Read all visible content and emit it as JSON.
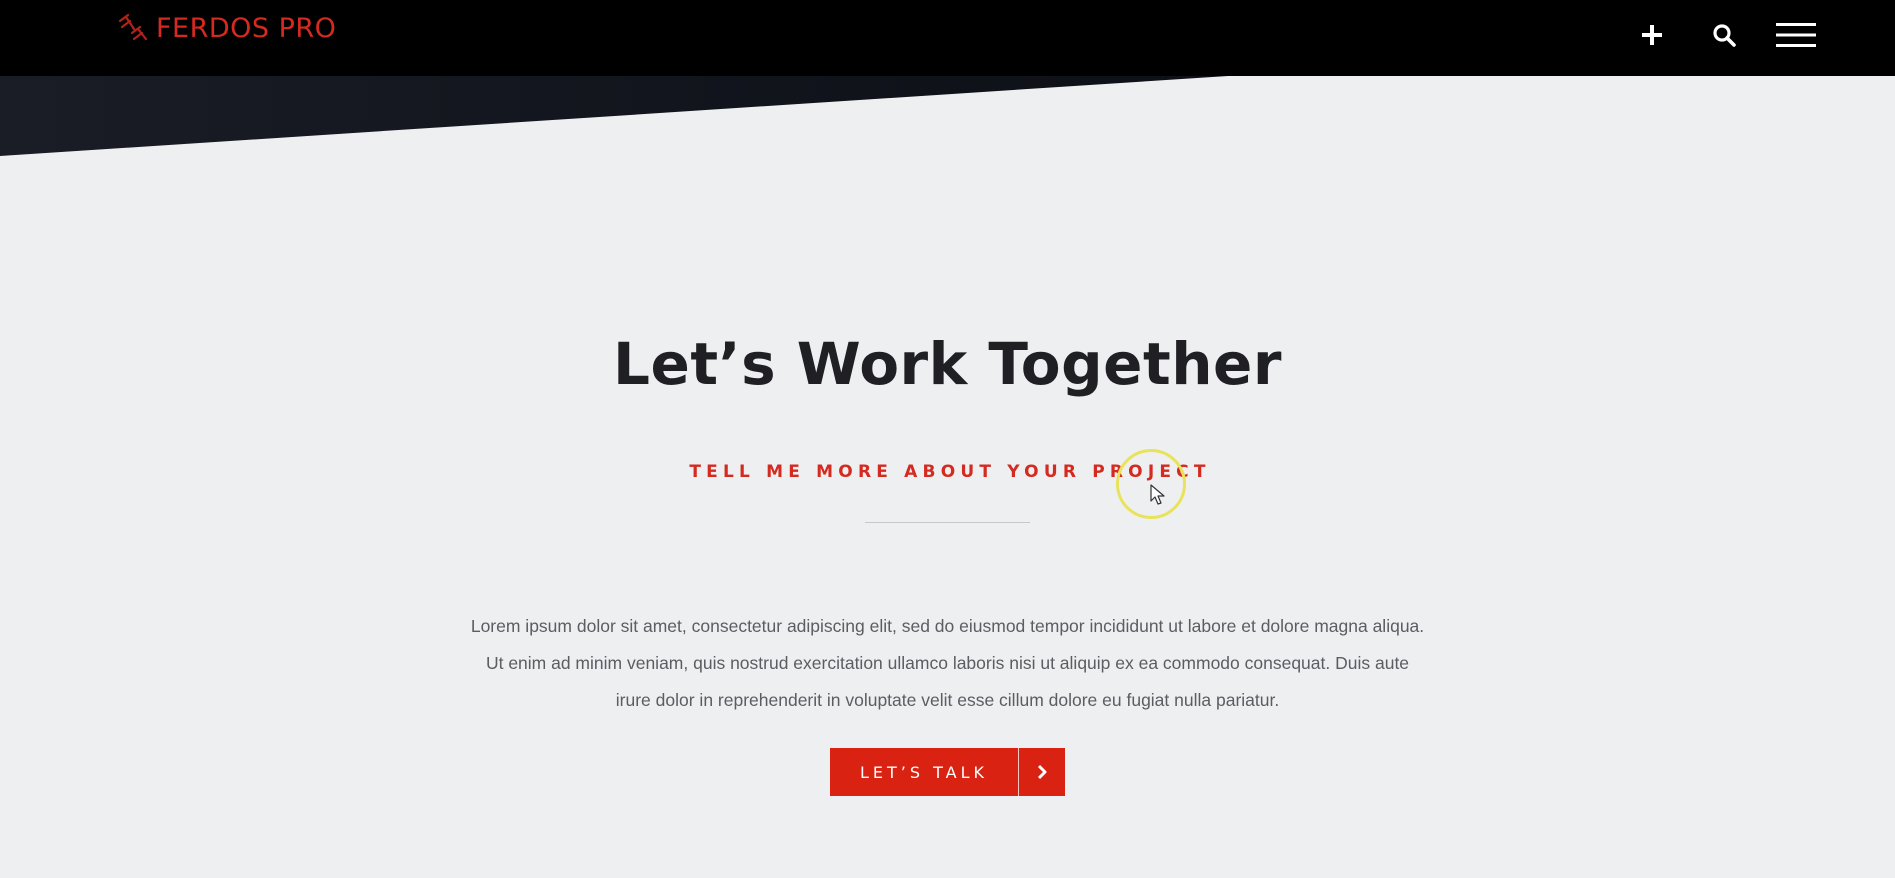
{
  "header": {
    "logo_text": "FERDOS PRO",
    "icons": [
      "plus-icon",
      "search-icon",
      "menu-icon"
    ]
  },
  "hero": {
    "heading": "Let’s Work Together",
    "subheading": "TELL ME MORE ABOUT YOUR PROJECT",
    "body": "Lorem ipsum dolor sit amet, consectetur adipiscing elit, sed do eiusmod tempor incididunt ut labore et dolore magna aliqua. Ut enim ad minim veniam, quis nostrud exercitation ullamco laboris nisi ut aliquip ex ea commodo consequat. Duis aute irure dolor in reprehenderit in voluptate velit esse cillum dolore eu fugiat nulla pariatur.",
    "cta_label": "LET’S TALK"
  },
  "colors": {
    "accent": "#d92211",
    "topbar": "#000000",
    "background": "#eeeff1",
    "heading": "#1f1f24",
    "body_text": "#5c5d63"
  }
}
